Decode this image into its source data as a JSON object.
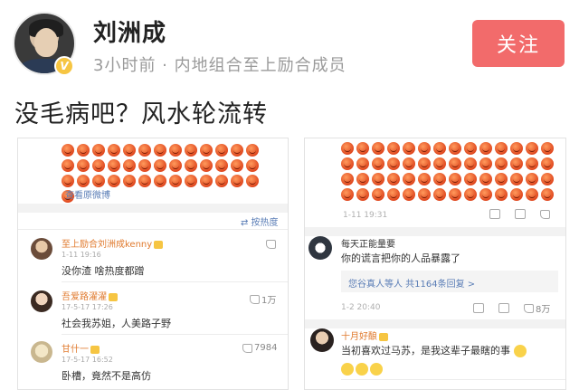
{
  "header": {
    "username": "刘洲成",
    "meta": "3小时前 · 内地组合至上励合成员",
    "follow_label": "关注"
  },
  "post": {
    "text": "没毛病吧？风水轮流转"
  },
  "left_card": {
    "view_original": "查看原微博",
    "sort_label": "⇄ 按热度",
    "comments": [
      {
        "name": "至上励合刘洲成kenny",
        "time": "1-11 19:16",
        "text": "没你渣  啥热度都蹭",
        "likes": ""
      },
      {
        "name": "吾爱路濯濯",
        "time": "17-5-17 17:26",
        "text": "社会我苏姐，人美路子野",
        "likes": "1万"
      },
      {
        "name": "甘什一",
        "time": "17-5-17 16:52",
        "text": "卧槽，竟然不是高仿",
        "likes": "7984"
      }
    ]
  },
  "right_card": {
    "post_time": "1-11 19:31",
    "comments": [
      {
        "name": "每天正能量要",
        "text": "你的谎言把你的人品暴露了",
        "reply": "您谷真人等人  共1164条回复 >",
        "time": "1-2 20:40",
        "likes": "8万"
      },
      {
        "name": "十月好酿",
        "text": "当初喜欢过马苏，是我这辈子最瞎的事"
      }
    ]
  },
  "colors": {
    "follow": "#f26b6b",
    "link": "#5a7db6",
    "orange_name": "#e07a2e"
  }
}
